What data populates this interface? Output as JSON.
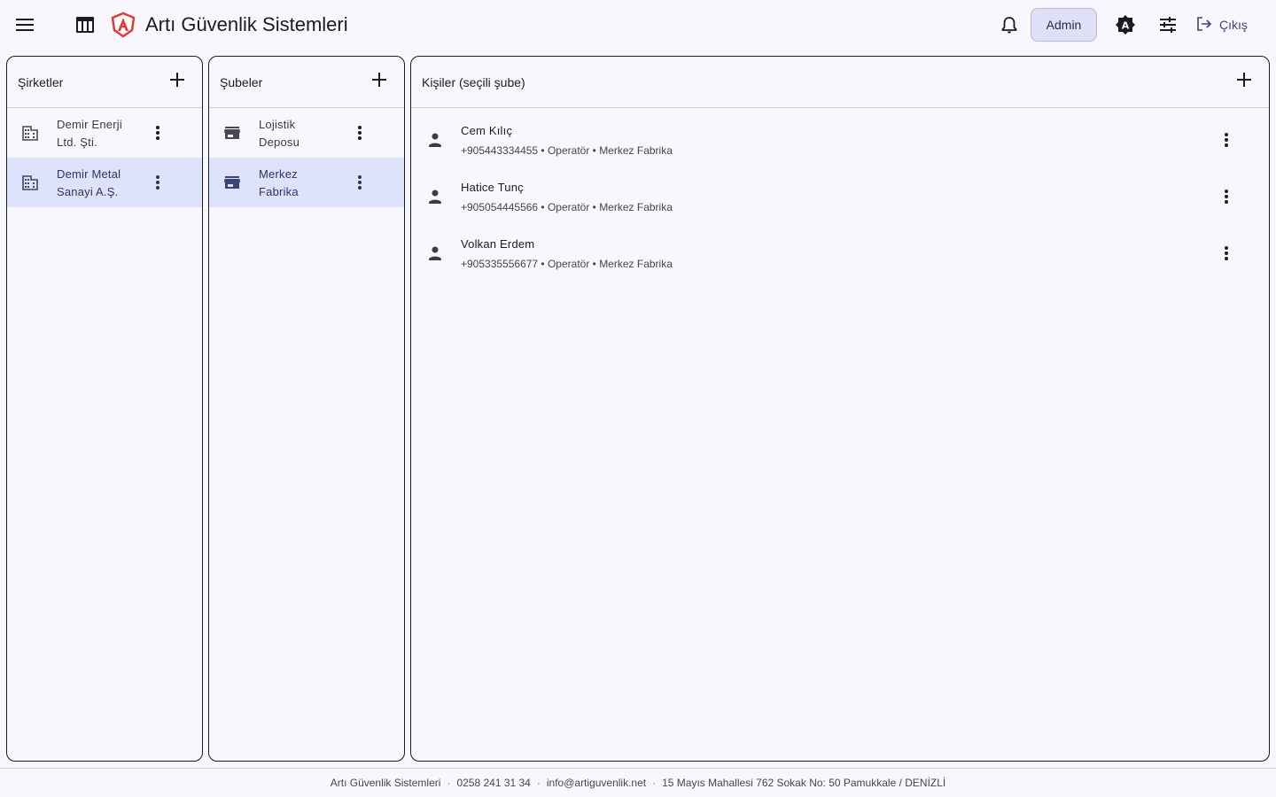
{
  "header": {
    "app_title": "Artı Güvenlik Sistemleri",
    "admin_label": "Admin",
    "logout_label": "Çıkış"
  },
  "companies": {
    "title": "Şirketler",
    "items": [
      {
        "line1": "Demir Enerji",
        "line2": "Ltd. Şti."
      },
      {
        "line1": "Demir Metal",
        "line2": "Sanayi A.Ş."
      }
    ]
  },
  "branches": {
    "title": "Şubeler",
    "items": [
      {
        "line1": "Lojistik",
        "line2": "Deposu"
      },
      {
        "line1": "Merkez",
        "line2": "Fabrika"
      }
    ]
  },
  "people": {
    "title": "Kişiler (seçili şube)",
    "items": [
      {
        "name": "Cem Kılıç",
        "meta": "+905443334455 • Operatör • Merkez Fabrika"
      },
      {
        "name": "Hatice Tunç",
        "meta": "+905054445566 • Operatör • Merkez Fabrika"
      },
      {
        "name": "Volkan Erdem",
        "meta": "+905335556677 • Operatör • Merkez Fabrika"
      }
    ]
  },
  "footer": {
    "company": "Artı Güvenlik Sistemleri",
    "phone": "0258 241 31 34",
    "email": "info@artiguvenlik.net",
    "address": "15 Mayıs Mahallesi 762 Sokak No: 50 Pamukkale / DENİZLİ"
  },
  "colors": {
    "selected_row": "#dfe2fb",
    "accent": "#3c4378",
    "logo_red": "#e53935"
  }
}
